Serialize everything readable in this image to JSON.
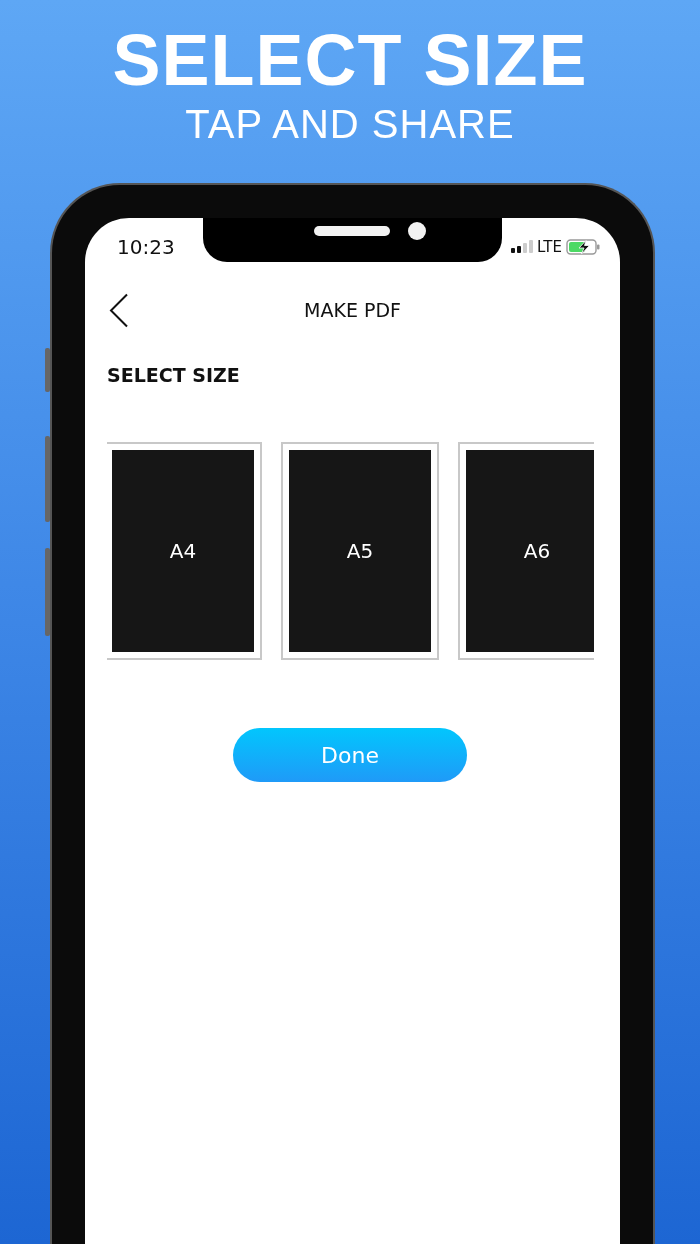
{
  "headline": "SELECT SIZE",
  "subheadline": "TAP AND SHARE",
  "status_bar": {
    "time": "10:23",
    "network": "LTE"
  },
  "nav": {
    "title": "MAKE PDF"
  },
  "section_title": "SELECT SIZE",
  "sizes": [
    {
      "label": "A4"
    },
    {
      "label": "A5"
    },
    {
      "label": "A6"
    }
  ],
  "done_button": "Done"
}
